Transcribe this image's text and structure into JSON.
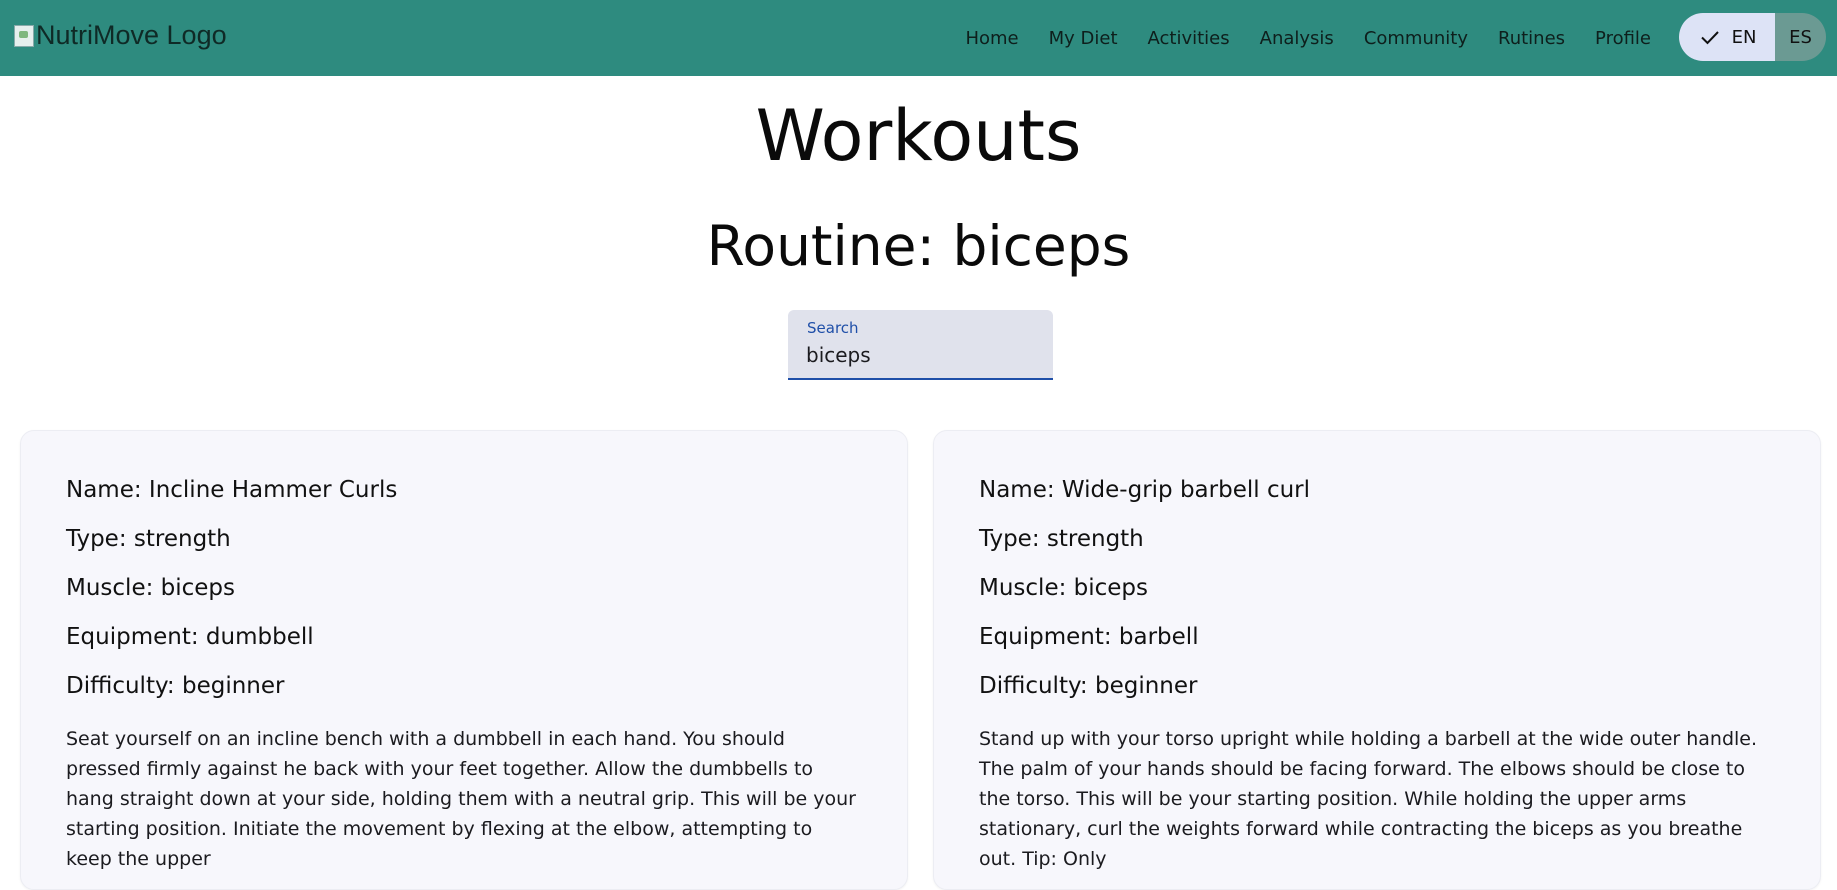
{
  "header": {
    "logo_alt": "NutriMove Logo",
    "nav": [
      "Home",
      "My Diet",
      "Activities",
      "Analysis",
      "Community",
      "Rutines",
      "Profile"
    ],
    "lang": {
      "en": "EN",
      "es": "ES",
      "selected": "EN"
    },
    "brand_color": "#2e8b7f"
  },
  "main": {
    "title": "Workouts",
    "routine": "Routine: biceps",
    "search": {
      "label": "Search",
      "value": "biceps"
    }
  },
  "cards": [
    {
      "name": "Name: Incline Hammer Curls",
      "type": "Type: strength",
      "muscle": "Muscle: biceps",
      "equipment": "Equipment: dumbbell",
      "difficulty": "Difficulty: beginner",
      "description": "Seat yourself on an incline bench with a dumbbell in each hand. You should pressed firmly against he back with your feet together. Allow the dumbbells to hang straight down at your side, holding them with a neutral grip. This will be your starting position. Initiate the movement by flexing at the elbow, attempting to keep the upper"
    },
    {
      "name": "Name: Wide-grip barbell curl",
      "type": "Type: strength",
      "muscle": "Muscle: biceps",
      "equipment": "Equipment: barbell",
      "difficulty": "Difficulty: beginner",
      "description": "Stand up with your torso upright while holding a barbell at the wide outer handle. The palm of your hands should be facing forward. The elbows should be close to the torso. This will be your starting position. While holding the upper arms stationary, curl the weights forward while contracting the biceps as you breathe out. Tip: Only"
    }
  ]
}
